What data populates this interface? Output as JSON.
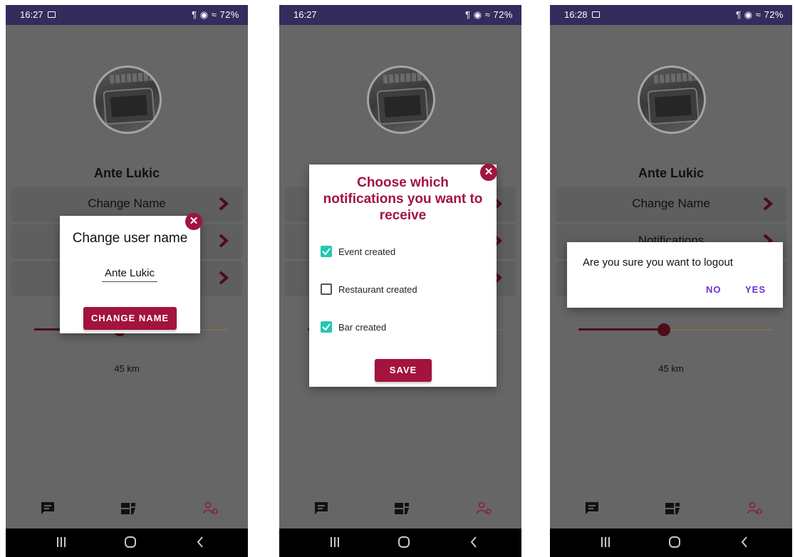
{
  "screens": [
    {
      "status": {
        "time": "16:27",
        "right": "¶ ◉ ≈ 72%",
        "show_image_icon": true
      },
      "user_name": "Ante Lukic",
      "rows": [
        "Change Name",
        "",
        ""
      ],
      "slider": {
        "value_fraction": 0.44
      },
      "distance_label": "45 km",
      "dialog": {
        "type": "change-name",
        "title": "Change user name",
        "input_value": "Ante Lukic",
        "button": "CHANGE NAME",
        "close_glyph": "✕"
      }
    },
    {
      "status": {
        "time": "16:27",
        "right": "¶ ◉ ≈ 72%",
        "show_image_icon": false
      },
      "user_name": "",
      "rows": [
        "",
        "",
        ""
      ],
      "slider": {
        "value_fraction": 0.44
      },
      "distance_label": "",
      "dialog": {
        "type": "notifications",
        "title_line1": "Choose which",
        "title_line2": "notifications you want to",
        "title_line3": "receive",
        "options": [
          {
            "label": "Event created",
            "checked": true
          },
          {
            "label": "Restaurant created",
            "checked": false
          },
          {
            "label": "Bar created",
            "checked": true
          }
        ],
        "button": "SAVE",
        "close_glyph": "✕"
      }
    },
    {
      "status": {
        "time": "16:28",
        "right": "¶ ◉ ≈ 72%",
        "show_image_icon": true
      },
      "user_name": "Ante Lukic",
      "rows": [
        "Change Name",
        "Notifications",
        ""
      ],
      "slider": {
        "value_fraction": 0.44
      },
      "distance_label": "45 km",
      "dialog": {
        "type": "logout",
        "message": "Are you sure you want to logout",
        "no": "NO",
        "yes": "YES"
      }
    }
  ],
  "colors": {
    "scrim": "#666666",
    "accent": "#a3133e",
    "slider_active": "#4b0d18",
    "slider_inactive": "#807046",
    "checkbox": "#26c6b1",
    "dialog_text_button": "#6b2fd6",
    "statusbar": "#332c5c"
  },
  "nav_icons": [
    "chat-icon",
    "dashboard-icon",
    "profile-settings-icon"
  ],
  "system_icons": [
    "recents-icon",
    "home-icon",
    "back-icon"
  ]
}
